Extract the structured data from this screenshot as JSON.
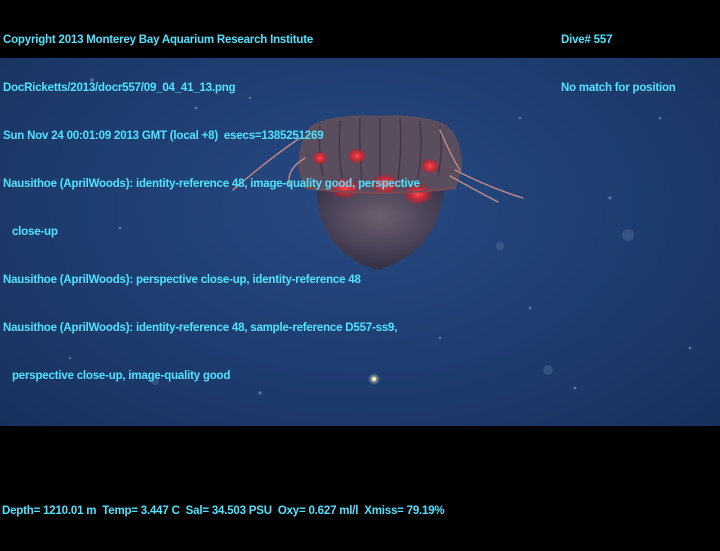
{
  "overlay": {
    "copyright": "Copyright 2013 Monterey Bay Aquarium Research Institute",
    "file": "DocRicketts/2013/docr557/09_04_41_13.png",
    "datetime": "Sun Nov 24 00:01:09 2013 GMT (local +8)  esecs=1385251269",
    "annotation_1a": "Nausithoe (AprilWoods): identity-reference 48, image-quality good, perspective",
    "annotation_1b": "   close-up",
    "annotation_2": "Nausithoe (AprilWoods): perspective close-up, identity-reference 48",
    "annotation_3a": "Nausithoe (AprilWoods): identity-reference 48, sample-reference D557-ss9,",
    "annotation_3b": "   perspective close-up, image-quality good",
    "dive": "Dive# 557",
    "position": "No match for position",
    "sensors": "Depth= 1210.01 m  Temp= 3.447 C  Sal= 34.503 PSU  Oxy= 0.627 ml/l  Xmiss= 79.19%"
  },
  "colors": {
    "overlay_text": "#4fe3ff",
    "water": "#1f3f73",
    "jelly_body": "#5a4f5f",
    "jelly_glow": "#ff2a2a"
  }
}
